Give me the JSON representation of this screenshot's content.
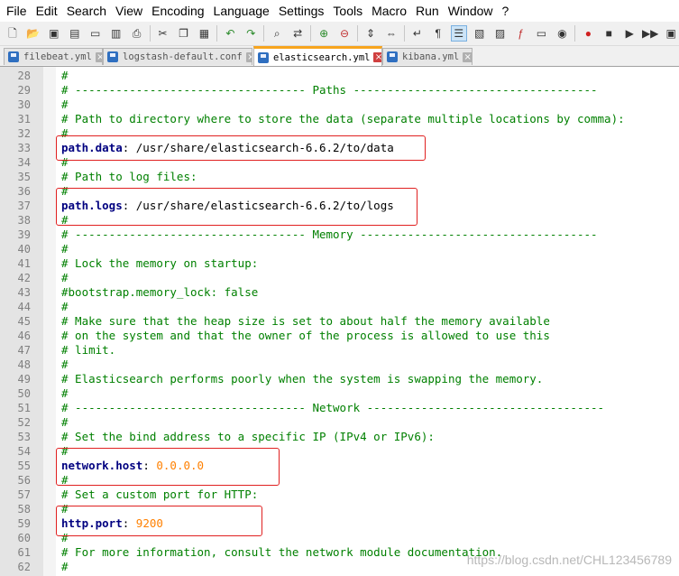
{
  "menu": [
    "File",
    "Edit",
    "Search",
    "View",
    "Encoding",
    "Language",
    "Settings",
    "Tools",
    "Macro",
    "Run",
    "Window",
    "?"
  ],
  "tabs": [
    {
      "label": "filebeat.yml",
      "active": false
    },
    {
      "label": "logstash-default.conf",
      "active": false
    },
    {
      "label": "elasticsearch.yml",
      "active": true
    },
    {
      "label": "kibana.yml",
      "active": false
    }
  ],
  "lines": [
    {
      "n": "28",
      "parts": [
        {
          "t": "#",
          "c": "comment"
        }
      ]
    },
    {
      "n": "29",
      "parts": [
        {
          "t": "# ---------------------------------- Paths ------------------------------------",
          "c": "comment"
        }
      ]
    },
    {
      "n": "30",
      "parts": [
        {
          "t": "#",
          "c": "comment"
        }
      ]
    },
    {
      "n": "31",
      "parts": [
        {
          "t": "# Path to directory where to store the data (separate multiple locations by comma):",
          "c": "comment"
        }
      ]
    },
    {
      "n": "32",
      "parts": [
        {
          "t": "#",
          "c": "comment"
        }
      ]
    },
    {
      "n": "33",
      "parts": [
        {
          "t": "path.data",
          "c": "key"
        },
        {
          "t": ": /usr/share/elasticsearch-6.6.2/to/data",
          "c": "plain"
        }
      ]
    },
    {
      "n": "34",
      "parts": [
        {
          "t": "#",
          "c": "comment"
        }
      ]
    },
    {
      "n": "35",
      "parts": [
        {
          "t": "# Path to log files:",
          "c": "comment"
        }
      ]
    },
    {
      "n": "36",
      "parts": [
        {
          "t": "#",
          "c": "comment"
        }
      ]
    },
    {
      "n": "37",
      "parts": [
        {
          "t": "path.logs",
          "c": "key"
        },
        {
          "t": ": /usr/share/elasticsearch-6.6.2/to/logs",
          "c": "plain"
        }
      ]
    },
    {
      "n": "38",
      "parts": [
        {
          "t": "#",
          "c": "comment"
        }
      ]
    },
    {
      "n": "39",
      "parts": [
        {
          "t": "# ---------------------------------- Memory -----------------------------------",
          "c": "comment"
        }
      ]
    },
    {
      "n": "40",
      "parts": [
        {
          "t": "#",
          "c": "comment"
        }
      ]
    },
    {
      "n": "41",
      "parts": [
        {
          "t": "# Lock the memory on startup:",
          "c": "comment"
        }
      ]
    },
    {
      "n": "42",
      "parts": [
        {
          "t": "#",
          "c": "comment"
        }
      ]
    },
    {
      "n": "43",
      "parts": [
        {
          "t": "#bootstrap.memory_lock: false",
          "c": "comment"
        }
      ]
    },
    {
      "n": "44",
      "parts": [
        {
          "t": "#",
          "c": "comment"
        }
      ]
    },
    {
      "n": "45",
      "parts": [
        {
          "t": "# Make sure that the heap size is set to about half the memory available",
          "c": "comment"
        }
      ]
    },
    {
      "n": "46",
      "parts": [
        {
          "t": "# on the system and that the owner of the process is allowed to use this",
          "c": "comment"
        }
      ]
    },
    {
      "n": "47",
      "parts": [
        {
          "t": "# limit.",
          "c": "comment"
        }
      ]
    },
    {
      "n": "48",
      "parts": [
        {
          "t": "#",
          "c": "comment"
        }
      ]
    },
    {
      "n": "49",
      "parts": [
        {
          "t": "# Elasticsearch performs poorly when the system is swapping the memory.",
          "c": "comment"
        }
      ]
    },
    {
      "n": "50",
      "parts": [
        {
          "t": "#",
          "c": "comment"
        }
      ]
    },
    {
      "n": "51",
      "parts": [
        {
          "t": "# ---------------------------------- Network -----------------------------------",
          "c": "comment"
        }
      ]
    },
    {
      "n": "52",
      "parts": [
        {
          "t": "#",
          "c": "comment"
        }
      ]
    },
    {
      "n": "53",
      "parts": [
        {
          "t": "# Set the bind address to a specific IP (IPv4 or IPv6):",
          "c": "comment"
        }
      ]
    },
    {
      "n": "54",
      "parts": [
        {
          "t": "#",
          "c": "comment"
        }
      ]
    },
    {
      "n": "55",
      "parts": [
        {
          "t": "network.host",
          "c": "key"
        },
        {
          "t": ": ",
          "c": "plain"
        },
        {
          "t": "0.0.0.0",
          "c": "num"
        }
      ]
    },
    {
      "n": "56",
      "parts": [
        {
          "t": "#",
          "c": "comment"
        }
      ]
    },
    {
      "n": "57",
      "parts": [
        {
          "t": "# Set a custom port for HTTP:",
          "c": "comment"
        }
      ]
    },
    {
      "n": "58",
      "parts": [
        {
          "t": "#",
          "c": "comment"
        }
      ]
    },
    {
      "n": "59",
      "parts": [
        {
          "t": "http.port",
          "c": "key"
        },
        {
          "t": ": ",
          "c": "plain"
        },
        {
          "t": "9200",
          "c": "num"
        }
      ]
    },
    {
      "n": "60",
      "parts": [
        {
          "t": "#",
          "c": "comment"
        }
      ]
    },
    {
      "n": "61",
      "parts": [
        {
          "t": "# For more information, consult the network module documentation.",
          "c": "comment"
        }
      ]
    },
    {
      "n": "62",
      "parts": [
        {
          "t": "#",
          "c": "comment"
        }
      ]
    }
  ],
  "watermark": "https://blog.csdn.net/CHL123456789",
  "colors": {
    "comment": "#008000",
    "key": "#000080",
    "number": "#ff8000",
    "highlight": "#e02020",
    "active_tab": "#f7a51e"
  }
}
